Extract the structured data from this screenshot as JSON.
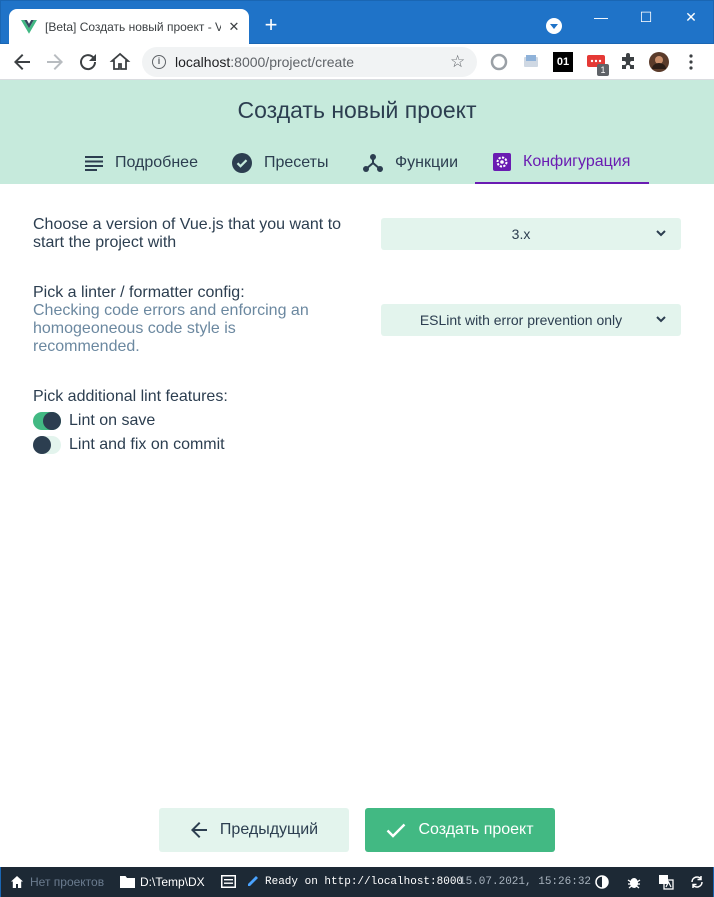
{
  "browser": {
    "tab_title": "[Beta] Создать новый проект - Vue CLI",
    "tab_close": "✕",
    "new_tab": "+",
    "url_host": "localhost",
    "url_rest": ":8000/project/create",
    "window_controls": {
      "minimize": "—",
      "maximize": "☐",
      "close": "✕"
    },
    "extensions": [
      "record-icon",
      "ebook-icon",
      "01",
      "apps-icon",
      "puzzle-icon",
      "avatar",
      "menu-icon"
    ],
    "ext_badge": "1"
  },
  "app": {
    "title": "Создать новый проект",
    "steps": [
      {
        "label": "Подробнее",
        "icon": "list-icon"
      },
      {
        "label": "Пресеты",
        "icon": "check-circle-icon"
      },
      {
        "label": "Функции",
        "icon": "share-nodes-icon"
      },
      {
        "label": "Конфигурация",
        "icon": "gear-icon",
        "active": true
      }
    ]
  },
  "form": {
    "vue_version": {
      "label_line1": "Choose a version of Vue.js that you want to",
      "label_line2": "start the project with",
      "value": "3.x"
    },
    "linter": {
      "label": "Pick a linter / formatter config:",
      "desc_line1": "Checking code errors and enforcing an",
      "desc_line2": "homogeoneous code style is",
      "desc_line3": "recommended.",
      "value": "ESLint with error prevention only"
    },
    "lint_features": {
      "label": "Pick additional lint features:",
      "options": [
        {
          "label": "Lint on save",
          "checked": true
        },
        {
          "label": "Lint and fix on commit",
          "checked": false
        }
      ]
    }
  },
  "buttons": {
    "prev": "Предыдущий",
    "create": "Создать проект"
  },
  "statusbar": {
    "no_projects": "Нет проектов",
    "folder": "D:\\Temp\\DX",
    "log": "Ready on http://localhost:8000",
    "datetime": "15.07.2021, 15:26:32"
  },
  "colors": {
    "accent": "#42b983",
    "header_bg": "#c6eadc",
    "active_step": "#6a1cb2",
    "titlebar": "#1f73c8",
    "statusbar": "#1d2935"
  }
}
